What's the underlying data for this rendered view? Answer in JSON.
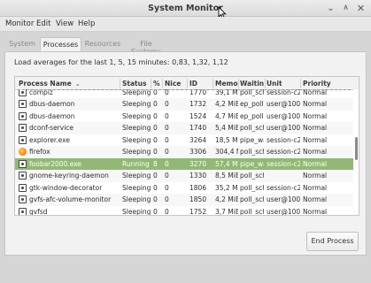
{
  "window": {
    "title": "System Monitor"
  },
  "menu": [
    "Monitor",
    "Edit",
    "View",
    "Help"
  ],
  "tabs": [
    {
      "label": "System",
      "active": false
    },
    {
      "label": "Processes",
      "active": true
    },
    {
      "label": "Resources",
      "active": false
    },
    {
      "label": "File Systems",
      "active": false
    }
  ],
  "load_averages": "Load averages for the last 1, 5, 15 minutes: 0,83, 1,32, 1,12",
  "columns": [
    "Process Name",
    "Status",
    "%",
    "Nice",
    "ID",
    "Memor",
    "Waitin",
    "Unit",
    "Priority"
  ],
  "rows": [
    {
      "name": "compiz",
      "status": "Sleeping",
      "cpu": "0",
      "nice": "0",
      "id": "1770",
      "mem": "39,1 MiB",
      "wait": "poll_sch",
      "unit": "session-c2",
      "priority": "Normal",
      "icon": "process-icon"
    },
    {
      "name": "dbus-daemon",
      "status": "Sleeping",
      "cpu": "0",
      "nice": "0",
      "id": "1732",
      "mem": "4,2 MiB",
      "wait": "ep_poll",
      "unit": "user@1000",
      "priority": "Normal",
      "icon": "process-icon"
    },
    {
      "name": "dbus-daemon",
      "status": "Sleeping",
      "cpu": "0",
      "nice": "0",
      "id": "1524",
      "mem": "4,7 MiB",
      "wait": "ep_poll",
      "unit": "user@1000",
      "priority": "Normal",
      "icon": "process-icon"
    },
    {
      "name": "dconf-service",
      "status": "Sleeping",
      "cpu": "0",
      "nice": "0",
      "id": "1740",
      "mem": "5,4 MiB",
      "wait": "poll_sch",
      "unit": "user@1000",
      "priority": "Normal",
      "icon": "process-icon"
    },
    {
      "name": "explorer.exe",
      "status": "Sleeping",
      "cpu": "0",
      "nice": "0",
      "id": "3264",
      "mem": "18,5 MiB",
      "wait": "pipe_wa",
      "unit": "session-c2",
      "priority": "Normal",
      "icon": "process-icon"
    },
    {
      "name": "firefox",
      "status": "Sleeping",
      "cpu": "0",
      "nice": "0",
      "id": "3306",
      "mem": "304,4 MiB",
      "wait": "poll_sch",
      "unit": "session-c2",
      "priority": "Normal",
      "icon": "firefox-icon"
    },
    {
      "name": "foobar2000.exe",
      "status": "Running",
      "cpu": "8",
      "nice": "0",
      "id": "3270",
      "mem": "57,4 MiB",
      "wait": "pipe_wa",
      "unit": "session-c2",
      "priority": "Normal",
      "icon": "process-icon",
      "selected": true
    },
    {
      "name": "gnome-keyring-daemon",
      "status": "Sleeping",
      "cpu": "0",
      "nice": "0",
      "id": "1330",
      "mem": "8,5 MiB",
      "wait": "poll_sch",
      "unit": "",
      "priority": "Normal",
      "icon": "process-icon"
    },
    {
      "name": "gtk-window-decorator",
      "status": "Sleeping",
      "cpu": "0",
      "nice": "0",
      "id": "1806",
      "mem": "35,2 MiB",
      "wait": "poll_sch",
      "unit": "session-c2",
      "priority": "Normal",
      "icon": "process-icon"
    },
    {
      "name": "gvfs-afc-volume-monitor",
      "status": "Sleeping",
      "cpu": "0",
      "nice": "0",
      "id": "1850",
      "mem": "4,2 MiB",
      "wait": "poll_sch",
      "unit": "user@1000",
      "priority": "Normal",
      "icon": "process-icon"
    },
    {
      "name": "gvfsd",
      "status": "Sleeping",
      "cpu": "0",
      "nice": "0",
      "id": "1752",
      "mem": "3,7 MiB",
      "wait": "poll_sch",
      "unit": "user@1000",
      "priority": "Normal",
      "icon": "process-icon"
    }
  ],
  "end_process_label": "End Process"
}
